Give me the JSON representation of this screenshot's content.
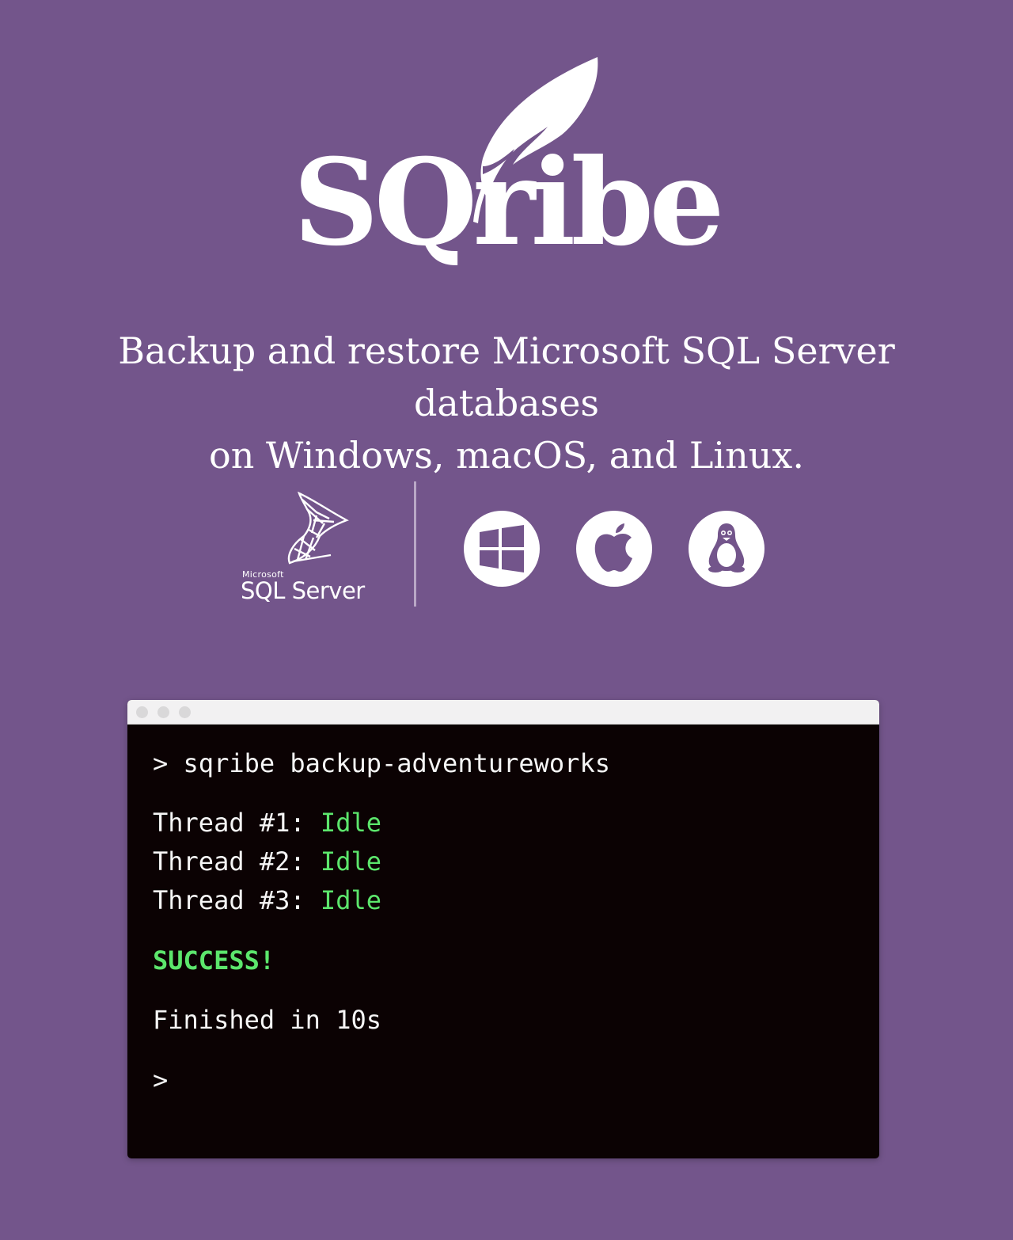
{
  "brand": {
    "name": "SQribe"
  },
  "tagline": {
    "line1": "Backup and restore Microsoft SQL Server databases",
    "line2": "on Windows, macOS, and Linux."
  },
  "platforms": {
    "sql_server_vendor": "Microsoft",
    "sql_server_name": "SQL Server",
    "os_icons": [
      "windows-icon",
      "apple-icon",
      "linux-icon"
    ]
  },
  "terminal": {
    "prompt": ">",
    "command": "sqribe backup-adventureworks",
    "threads": [
      {
        "label": "Thread #1:",
        "status": "Idle"
      },
      {
        "label": "Thread #2:",
        "status": "Idle"
      },
      {
        "label": "Thread #3:",
        "status": "Idle"
      }
    ],
    "result": "SUCCESS!",
    "finished": "Finished in 10s",
    "final_prompt": ">"
  },
  "colors": {
    "background": "#73558b",
    "terminal_bg": "#0b0203",
    "success_green": "#5ce66c"
  }
}
